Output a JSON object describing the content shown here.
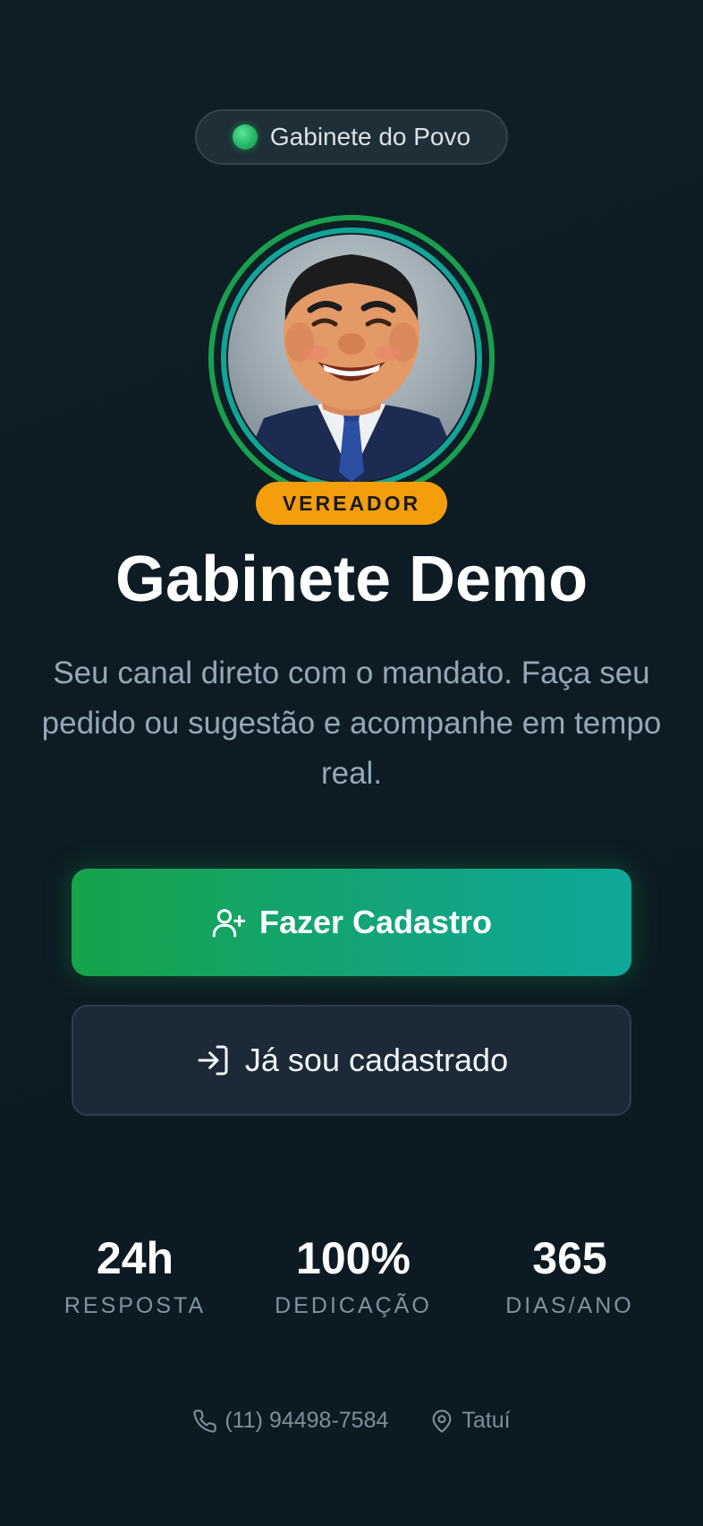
{
  "top_pill": {
    "label": "Gabinete do Povo",
    "dot_color": "#22b866"
  },
  "profile": {
    "role_badge": "VEREADOR",
    "badge_color": "#f59e0b"
  },
  "hero": {
    "title": "Gabinete Demo",
    "subtitle": "Seu canal direto com o mandato. Faça seu pedido ou sugestão e acompanhe em tempo real."
  },
  "actions": {
    "primary_label": "Fazer Cadastro",
    "primary_icon": "user-plus-icon",
    "secondary_label": "Já sou cadastrado",
    "secondary_icon": "log-in-icon"
  },
  "stats": [
    {
      "value": "24h",
      "label": "RESPOSTA"
    },
    {
      "value": "100%",
      "label": "DEDICAÇÃO"
    },
    {
      "value": "365",
      "label": "DIAS/ANO"
    }
  ],
  "footer": {
    "phone": "(11) 94498-7584",
    "phone_icon": "phone-icon",
    "city": "Tatuí",
    "city_icon": "map-pin-icon"
  },
  "colors": {
    "accent_green": "#17a34a",
    "accent_teal": "#0fa89a",
    "background": "#0f1f26"
  }
}
